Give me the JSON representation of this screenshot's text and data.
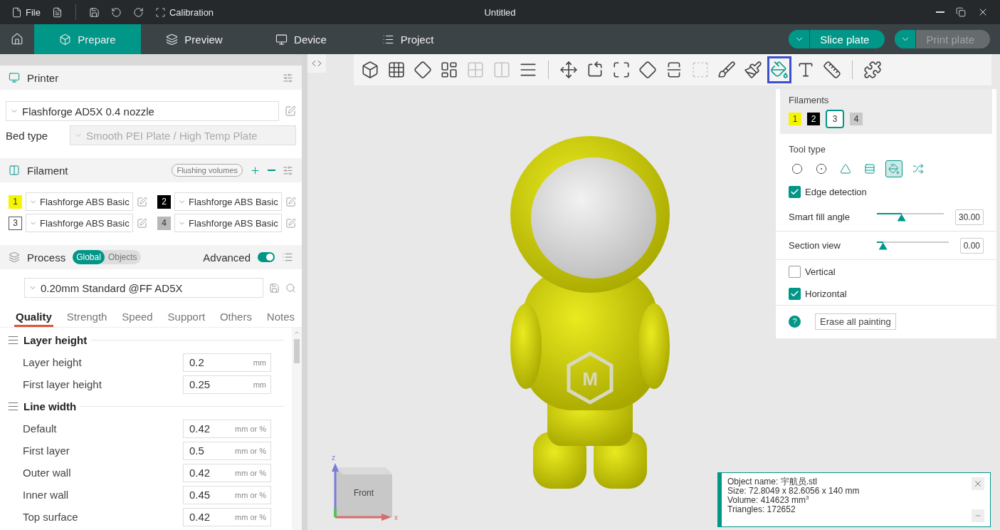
{
  "title_bar": {
    "file_label": "File",
    "calibration_label": "Calibration",
    "title": "Untitled"
  },
  "tabs": [
    {
      "label": "Prepare",
      "kind": "cube",
      "selected": true
    },
    {
      "label": "Preview",
      "kind": "layers",
      "selected": false
    },
    {
      "label": "Device",
      "kind": "device",
      "selected": false
    },
    {
      "label": "Project",
      "kind": "list",
      "selected": false
    }
  ],
  "actions": [
    {
      "label": "Slice plate",
      "disabled": false
    },
    {
      "label": "Print plate",
      "disabled": true
    }
  ],
  "printer": {
    "title": "Printer",
    "preset": "Flashforge AD5X 0.4 nozzle",
    "bed_label": "Bed type",
    "bed_value": "Smooth PEI Plate / High Temp Plate"
  },
  "filament": {
    "title": "Filament",
    "flushing_label": "Flushing volumes",
    "slots": [
      {
        "number": "1",
        "color": "#f5f500",
        "name": "Flashforge ABS Basic"
      },
      {
        "number": "2",
        "color": "#000000",
        "name": "Flashforge ABS Basic"
      },
      {
        "number": "3",
        "color": "#ffffff",
        "name": "Flashforge ABS Basic"
      },
      {
        "number": "4",
        "color": "#b8b8b8",
        "name": "Flashforge ABS Basic"
      }
    ]
  },
  "process": {
    "title": "Process",
    "scopes": [
      {
        "label": "Global",
        "selected": true
      },
      {
        "label": "Objects",
        "selected": false
      }
    ],
    "advanced_label": "Advanced",
    "advanced_on": true,
    "preset": "0.20mm Standard @FF AD5X",
    "tabs": [
      {
        "label": "Quality",
        "selected": true
      },
      {
        "label": "Strength",
        "selected": false
      },
      {
        "label": "Speed",
        "selected": false
      },
      {
        "label": "Support",
        "selected": false
      },
      {
        "label": "Others",
        "selected": false
      },
      {
        "label": "Notes",
        "selected": false
      }
    ],
    "groups": [
      {
        "title": "Layer height",
        "rows": [
          {
            "label": "Layer height",
            "value": "0.2",
            "unit": "mm"
          },
          {
            "label": "First layer height",
            "value": "0.25",
            "unit": "mm"
          }
        ]
      },
      {
        "title": "Line width",
        "rows": [
          {
            "label": "Default",
            "value": "0.42",
            "unit": "mm or %"
          },
          {
            "label": "First layer",
            "value": "0.5",
            "unit": "mm or %"
          },
          {
            "label": "Outer wall",
            "value": "0.42",
            "unit": "mm or %"
          },
          {
            "label": "Inner wall",
            "value": "0.45",
            "unit": "mm or %"
          },
          {
            "label": "Top surface",
            "value": "0.42",
            "unit": "mm or %"
          }
        ]
      }
    ]
  },
  "toolbar": {
    "groups": [
      {
        "tools": [
          {
            "kind": "add-object",
            "selected": false,
            "disabled": false
          },
          {
            "kind": "add-plate",
            "selected": false,
            "disabled": false
          },
          {
            "kind": "orient",
            "selected": false,
            "disabled": false
          },
          {
            "kind": "arrange",
            "selected": false,
            "disabled": false
          },
          {
            "kind": "split-objects",
            "selected": false,
            "disabled": true
          },
          {
            "kind": "split-parts",
            "selected": false,
            "disabled": true
          },
          {
            "kind": "layers",
            "selected": false,
            "disabled": false
          }
        ]
      },
      {
        "tools": [
          {
            "kind": "move",
            "selected": false,
            "disabled": false
          },
          {
            "kind": "rotate",
            "selected": false,
            "disabled": false
          },
          {
            "kind": "scale",
            "selected": false,
            "disabled": false
          },
          {
            "kind": "lay-on-face",
            "selected": false,
            "disabled": false
          },
          {
            "kind": "cut",
            "selected": false,
            "disabled": false
          },
          {
            "kind": "boolean",
            "selected": false,
            "disabled": true
          },
          {
            "kind": "support-paint",
            "selected": false,
            "disabled": false
          },
          {
            "kind": "seam-paint",
            "selected": false,
            "disabled": false
          },
          {
            "kind": "color-paint",
            "selected": true,
            "disabled": false
          },
          {
            "kind": "text",
            "selected": false,
            "disabled": false
          },
          {
            "kind": "measure",
            "selected": false,
            "disabled": false
          }
        ]
      },
      {
        "tools": [
          {
            "kind": "assembly",
            "selected": false,
            "disabled": false
          }
        ]
      }
    ]
  },
  "paint_panel": {
    "filaments_title": "Filaments",
    "filaments": [
      {
        "number": "1",
        "color": "#f5f500",
        "selected": false
      },
      {
        "number": "2",
        "color": "#000000",
        "selected": false
      },
      {
        "number": "3",
        "color": "#ffffff",
        "selected": true
      },
      {
        "number": "4",
        "color": "#c8c8c8",
        "selected": false
      }
    ],
    "tool_type_title": "Tool type",
    "tools": [
      {
        "kind": "circle",
        "selected": false
      },
      {
        "kind": "sphere",
        "selected": false
      },
      {
        "kind": "triangle",
        "selected": false
      },
      {
        "kind": "height-range",
        "selected": false
      },
      {
        "kind": "fill",
        "selected": true
      },
      {
        "kind": "gap-fill",
        "selected": false
      }
    ],
    "options": [
      {
        "kind": "checkbox",
        "label": "Edge detection",
        "checked": true
      },
      {
        "kind": "slider",
        "label": "Smart fill angle",
        "level": 0.35,
        "value": "30.00"
      },
      {
        "kind": "slider",
        "label": "Section view",
        "level": 0.03,
        "value": "0.00"
      },
      {
        "kind": "checkbox",
        "label": "Vertical",
        "checked": false
      },
      {
        "kind": "checkbox",
        "label": "Horizontal",
        "checked": true
      }
    ],
    "help": "?",
    "erase_label": "Erase all painting"
  },
  "model_logo": "M",
  "view_cube": {
    "face": "Front",
    "z_axis": "z",
    "x_axis": "x"
  },
  "object_info": {
    "lines": [
      "Object name: 宇航员.stl",
      "Size: 72.8049 x 82.6056 x 140 mm",
      "Volume: 414623 mm$^{3}$",
      "Triangles: 172652"
    ]
  }
}
